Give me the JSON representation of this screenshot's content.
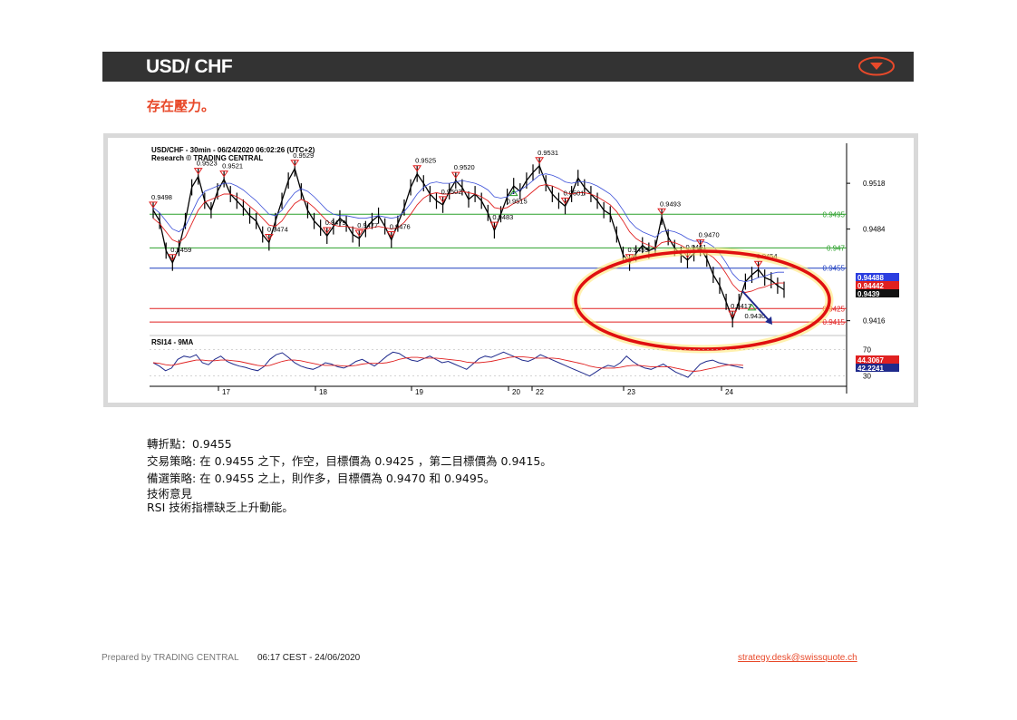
{
  "header": {
    "title": "USD/ CHF",
    "accent_color": "#e8492a",
    "bar_color": "#333333"
  },
  "subtitle": "存在壓力。",
  "chart_data": {
    "type": "line",
    "title": "USD/CHF - 30min - 06/24/2020 06:02:26 (UTC+2)",
    "subtitle": "Research © TRADING CENTRAL",
    "x_tick_labels": [
      "17",
      "18",
      "19",
      "20",
      "22",
      "23",
      "24"
    ],
    "y_tick_labels": [
      "0.9518",
      "0.9484",
      "0.9416"
    ],
    "ylim": [
      0.9405,
      0.9545
    ],
    "series": [
      {
        "values": [
          0.9498,
          0.949,
          0.9468,
          0.9459,
          0.947,
          0.949,
          0.9515,
          0.9523,
          0.9505,
          0.9498,
          0.9512,
          0.9521,
          0.951,
          0.9505,
          0.95,
          0.9494,
          0.949,
          0.948,
          0.9474,
          0.949,
          0.9505,
          0.952,
          0.9529,
          0.9512,
          0.9498,
          0.949,
          0.9485,
          0.9479,
          0.9486,
          0.9492,
          0.9488,
          0.948,
          0.9477,
          0.9484,
          0.949,
          0.9494,
          0.9486,
          0.9476,
          0.9488,
          0.95,
          0.9515,
          0.9525,
          0.9518,
          0.951,
          0.9505,
          0.9502,
          0.9512,
          0.952,
          0.9515,
          0.9506,
          0.951,
          0.9505,
          0.9496,
          0.9483,
          0.9495,
          0.9508,
          0.9516,
          0.9512,
          0.952,
          0.9526,
          0.9531,
          0.9518,
          0.951,
          0.9505,
          0.9501,
          0.951,
          0.9522,
          0.9515,
          0.951,
          0.9505,
          0.9498,
          0.9495,
          0.948,
          0.9465,
          0.9459,
          0.9466,
          0.9472,
          0.9468,
          0.947,
          0.9493,
          0.9478,
          0.947,
          0.9465,
          0.9461,
          0.9466,
          0.947,
          0.9462,
          0.945,
          0.9442,
          0.943,
          0.9417,
          0.943,
          0.9445,
          0.945,
          0.9454,
          0.9448,
          0.9446,
          0.9442,
          0.9439
        ]
      },
      {
        "name": "9MA",
        "values": [
          0.9492,
          0.9488,
          0.9482,
          0.9476,
          0.9474,
          0.9478,
          0.9488,
          0.9498,
          0.9504,
          0.9506,
          0.9508,
          0.951,
          0.951,
          0.9508,
          0.9505,
          0.9501,
          0.9497,
          0.9492,
          0.9487,
          0.9486,
          0.949,
          0.9497,
          0.9503,
          0.9506,
          0.9504,
          0.95,
          0.9495,
          0.949,
          0.9487,
          0.9486,
          0.9486,
          0.9485,
          0.9484,
          0.9484,
          0.9485,
          0.9486,
          0.9485,
          0.9484,
          0.9485,
          0.9489,
          0.9495,
          0.9502,
          0.9507,
          0.951,
          0.9511,
          0.951,
          0.951,
          0.9511,
          0.9512,
          0.9511,
          0.951,
          0.9508,
          0.9505,
          0.95,
          0.9499,
          0.95,
          0.9503,
          0.9505,
          0.9508,
          0.9512,
          0.9516,
          0.9517,
          0.9516,
          0.9514,
          0.9511,
          0.951,
          0.9511,
          0.9511,
          0.951,
          0.9508,
          0.9505,
          0.9502,
          0.9497,
          0.949,
          0.9482,
          0.9477,
          0.9474,
          0.9472,
          0.947,
          0.9474,
          0.9475,
          0.9474,
          0.9472,
          0.9469,
          0.9467,
          0.9467,
          0.9466,
          0.9463,
          0.9458,
          0.9451,
          0.9443,
          0.9438,
          0.9437,
          0.9438,
          0.944,
          0.9441,
          0.9443,
          0.9444,
          0.9444
        ]
      }
    ],
    "price_labels": [
      "0.9523",
      "0.9521",
      "0.9529",
      "0.9525",
      "0.9520",
      "0.9515",
      "0.9531",
      "0.9498",
      "0.9502",
      "0.9501",
      "0.9483",
      "0.9479",
      "0.9477",
      "0.9476",
      "0.9474",
      "0.9459",
      "0.9493",
      "0.9470",
      "0.9454",
      "0.9459",
      "0.9461",
      "0.9430",
      "0.9417"
    ],
    "horizontal_lines": [
      {
        "label": "0.9495",
        "value": 0.9495,
        "color": "#2ca02c"
      },
      {
        "label": "0.947",
        "value": 0.947,
        "color": "#2ca02c"
      },
      {
        "label": "0.9455",
        "value": 0.9455,
        "color": "#1f3fbf"
      },
      {
        "label": "0.9425",
        "value": 0.9425,
        "color": "#e02020"
      },
      {
        "label": "0.9415",
        "value": 0.9415,
        "color": "#e02020"
      }
    ],
    "price_tags": [
      {
        "label": "0.94488",
        "color": "#2b3ee0"
      },
      {
        "label": "0.94442",
        "color": "#e02020"
      },
      {
        "label": "0.9439",
        "color": "#111111"
      }
    ],
    "indicator": {
      "label": "RSI14 - 9MA",
      "levels": [
        "70",
        "30"
      ],
      "tags": [
        {
          "label": "44.3067",
          "color": "#e02020"
        },
        {
          "label": "42.2241",
          "color": "#1f2a8c"
        }
      ],
      "rsi_values": [
        50,
        45,
        38,
        42,
        55,
        60,
        58,
        62,
        50,
        47,
        55,
        60,
        52,
        48,
        45,
        43,
        40,
        38,
        44,
        55,
        62,
        65,
        58,
        50,
        45,
        42,
        40,
        44,
        50,
        48,
        44,
        42,
        46,
        52,
        55,
        50,
        45,
        52,
        60,
        66,
        64,
        58,
        54,
        52,
        56,
        60,
        55,
        50,
        52,
        48,
        44,
        40,
        48,
        56,
        60,
        58,
        62,
        66,
        62,
        58,
        54,
        52,
        56,
        62,
        58,
        54,
        50,
        46,
        42,
        38,
        34,
        30,
        36,
        42,
        46,
        44,
        50,
        60,
        52,
        46,
        42,
        40,
        44,
        48,
        42,
        36,
        32,
        28,
        38,
        48,
        52,
        54,
        50,
        48,
        46,
        44,
        42
      ],
      "ma_values": [
        50,
        49,
        47,
        46,
        48,
        50,
        52,
        54,
        54,
        53,
        53,
        54,
        54,
        53,
        52,
        50,
        48,
        46,
        45,
        46,
        49,
        52,
        54,
        54,
        53,
        51,
        49,
        47,
        46,
        46,
        46,
        45,
        45,
        46,
        48,
        49,
        49,
        49,
        50,
        52,
        55,
        57,
        58,
        58,
        57,
        57,
        57,
        56,
        55,
        54,
        53,
        51,
        50,
        50,
        51,
        52,
        54,
        56,
        58,
        59,
        59,
        58,
        57,
        57,
        57,
        57,
        56,
        54,
        52,
        50,
        48,
        45,
        43,
        42,
        42,
        42,
        43,
        45,
        46,
        46,
        45,
        44,
        44,
        44,
        44,
        42,
        40,
        38,
        37,
        38,
        40,
        42,
        44,
        46,
        47,
        47,
        46
      ]
    },
    "grid": false
  },
  "analysis": {
    "pivot_line": "轉折點：0.9455",
    "strategy_line": "交易策略: 在 0.9455 之下，作空，目標價為  0.9425 ，第二目標價為  0.9415。",
    "alt_line": "備選策略: 在 0.9455 之上，則作多，目標價為  0.9470 和 0.9495。",
    "opinion_title": "技術意見",
    "opinion_text": "RSI 技術指標缺乏上升動能。"
  },
  "footer": {
    "prepared_by": "Prepared by TRADING CENTRAL",
    "timestamp": "06:17 CEST  - 24/06/2020",
    "email": "strategy.desk@swissquote.ch"
  }
}
